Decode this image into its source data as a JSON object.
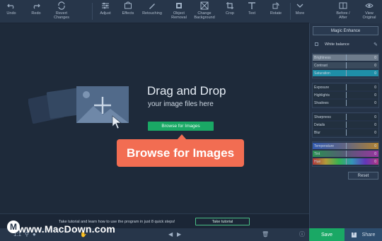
{
  "toolbar": {
    "items": [
      {
        "label": "Undo",
        "icon": "undo-icon"
      },
      {
        "label": "Redo",
        "icon": "redo-icon"
      },
      {
        "label": "Revert\nChanges",
        "icon": "revert-icon"
      },
      {
        "label": "Adjust",
        "icon": "sliders-icon"
      },
      {
        "label": "Effects",
        "icon": "effects-icon"
      },
      {
        "label": "Retouching",
        "icon": "brush-icon"
      },
      {
        "label": "Object\nRemoval",
        "icon": "eraser-icon"
      },
      {
        "label": "Change\nBackground",
        "icon": "background-icon"
      },
      {
        "label": "Crop",
        "icon": "crop-icon"
      },
      {
        "label": "Text",
        "icon": "text-icon"
      },
      {
        "label": "Rotate",
        "icon": "rotate-icon"
      },
      {
        "label": "More",
        "icon": "chevron-down-icon"
      }
    ],
    "before_after": "Before /\nAfter",
    "view_original": "View\nOriginal"
  },
  "canvas": {
    "title": "Drag and Drop",
    "subtitle": "your image files here",
    "browse_label": "Browse for Images",
    "callout_label": "Browse for Images"
  },
  "tutorial": {
    "text": "Take tutorial and learn how to use the program in just 8 quick steps!",
    "button": "Take tutorial"
  },
  "watermark": {
    "badge": "M",
    "text": "www.MacDown.com"
  },
  "bottom": {
    "zoom": "1:1",
    "save": "Save",
    "share": "Share",
    "share_icon": "f"
  },
  "panel": {
    "magic_enhance": "Magic Enhance",
    "white_balance": "White balance",
    "sliders_group1": [
      {
        "name": "Brightness",
        "value": "0",
        "level": 0.5,
        "color": "#6e7c8c"
      },
      {
        "name": "Contrast",
        "value": "0",
        "level": 0.5,
        "color": "#3a4a5c"
      },
      {
        "name": "Saturation",
        "value": "0",
        "level": 0.5,
        "color": "#1f8fa8"
      }
    ],
    "sliders_group2": [
      {
        "name": "Exposure",
        "value": "0",
        "level": 0.5,
        "color": "#22303f"
      },
      {
        "name": "Highlights",
        "value": "0",
        "level": 0.5,
        "color": "#22303f"
      },
      {
        "name": "Shadows",
        "value": "0",
        "level": 0.5,
        "color": "#22303f"
      }
    ],
    "sliders_group3": [
      {
        "name": "Sharpness",
        "value": "0",
        "level": 0.5,
        "color": "#22303f"
      },
      {
        "name": "Details",
        "value": "0",
        "level": 0.5,
        "color": "#22303f"
      },
      {
        "name": "Blur",
        "value": "0",
        "level": 0.5,
        "color": "#22303f"
      }
    ],
    "sliders_group4": [
      {
        "name": "Temperature",
        "value": "0",
        "level": 0.5,
        "color": "temperature"
      },
      {
        "name": "Tint",
        "value": "0",
        "level": 0.5,
        "color": "tint"
      },
      {
        "name": "Hue",
        "value": "0",
        "level": 0.5,
        "color": "hue"
      }
    ],
    "reset": "Reset"
  },
  "colors": {
    "accent_green": "#1aa865",
    "callout": "#f26d52",
    "background": "#1e2a3a"
  }
}
